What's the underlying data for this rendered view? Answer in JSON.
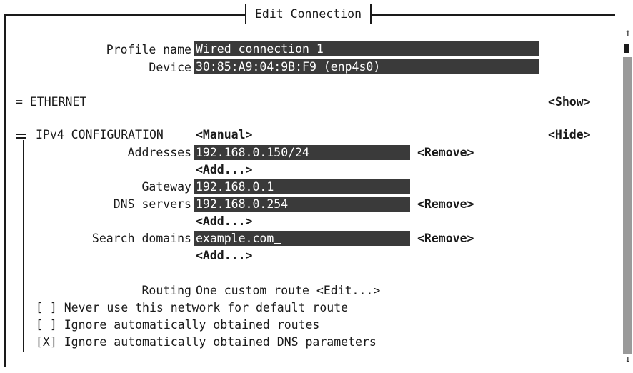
{
  "window": {
    "title": "Edit Connection"
  },
  "profile": {
    "name_label": "Profile name",
    "name_value": "Wired connection 1",
    "device_label": "Device",
    "device_value": "30:85:A9:04:9B:F9 (enp4s0)"
  },
  "ethernet": {
    "label": "= ETHERNET",
    "toggle": "<Show>"
  },
  "ipv4": {
    "label": "IPv4 CONFIGURATION",
    "mode": "<Manual>",
    "toggle": "<Hide>",
    "addresses_label": "Addresses",
    "addresses_value": "192.168.0.150/24",
    "gateway_label": "Gateway",
    "gateway_value": "192.168.0.1",
    "dns_label": "DNS servers",
    "dns_value": "192.168.0.254",
    "search_label": "Search domains",
    "search_value": "example.com",
    "remove": "<Remove>",
    "add": "<Add...>",
    "routing_label": "Routing",
    "routing_value": "One custom route",
    "routing_edit": "<Edit...>",
    "never_default_checkbox": "[ ]",
    "never_default_label": "Never use this network for default route",
    "ignore_routes_checkbox": "[ ]",
    "ignore_routes_label": "Ignore automatically obtained routes",
    "ignore_dns_checkbox": "[X]",
    "ignore_dns_label": "Ignore automatically obtained DNS parameters"
  },
  "scrollbar": {
    "up": "↑",
    "down": "↓"
  }
}
